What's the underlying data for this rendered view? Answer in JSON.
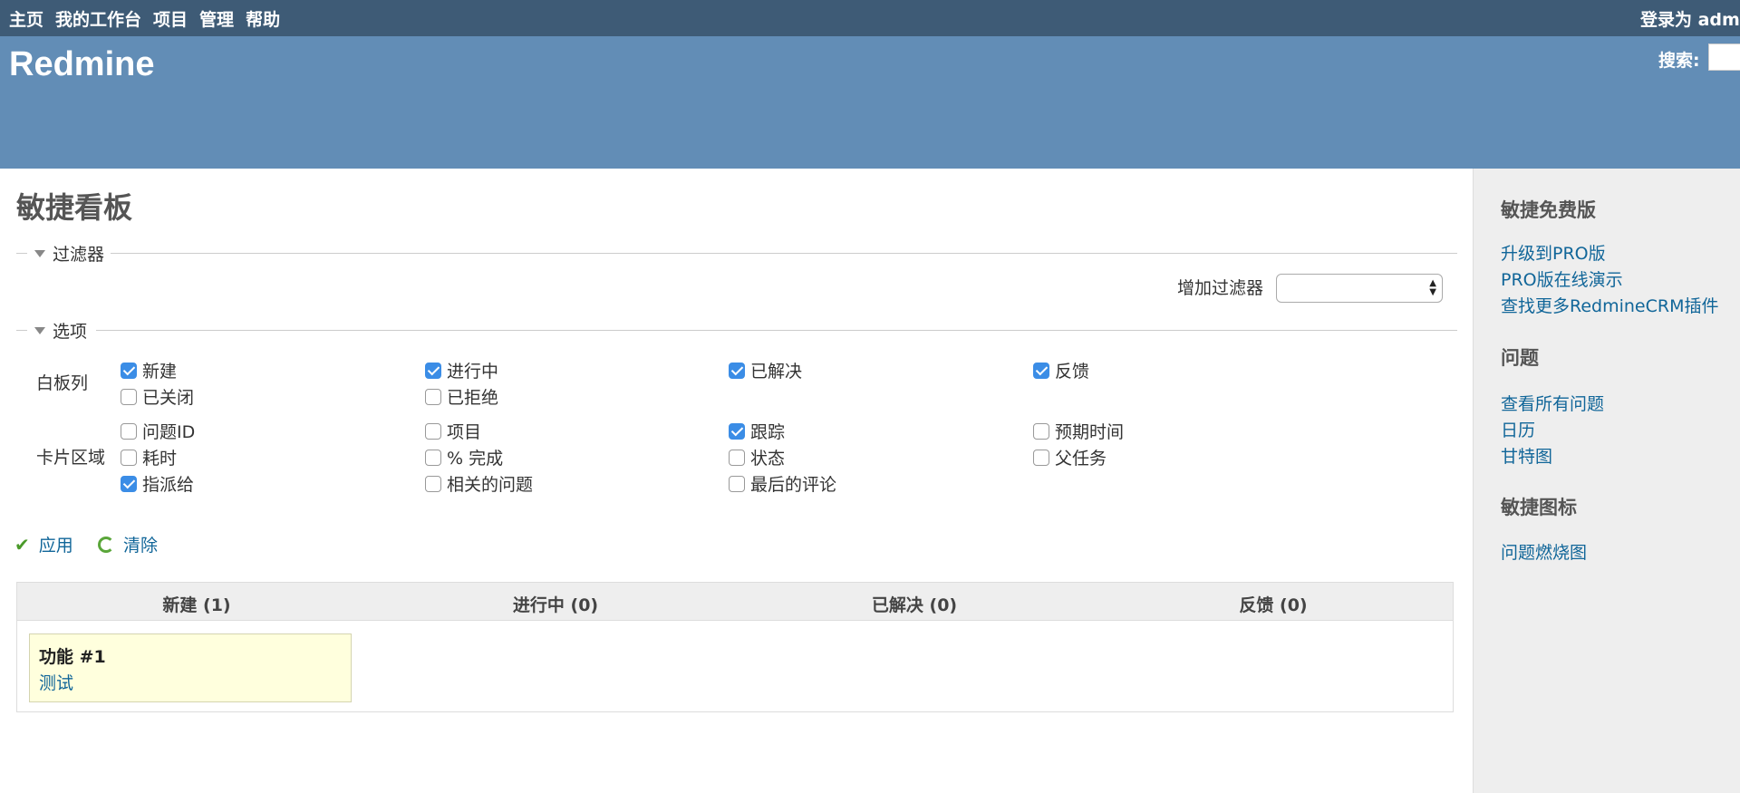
{
  "top_menu": {
    "items": [
      "主页",
      "我的工作台",
      "项目",
      "管理",
      "帮助"
    ],
    "login": "登录为 adm"
  },
  "header": {
    "title": "Redmine",
    "search_label": "搜索:",
    "search_value": ""
  },
  "page": {
    "title": "敏捷看板",
    "filters_legend": "过滤器",
    "add_filter_label": "增加过滤器",
    "add_filter_selected": "",
    "options_legend": "选项",
    "board_columns_label": "白板列",
    "card_fields_label": "卡片区域",
    "board_columns": [
      {
        "label": "新建",
        "checked": true
      },
      {
        "label": "进行中",
        "checked": true
      },
      {
        "label": "已解决",
        "checked": true
      },
      {
        "label": "反馈",
        "checked": true
      },
      {
        "label": "已关闭",
        "checked": false
      },
      {
        "label": "已拒绝",
        "checked": false
      }
    ],
    "card_fields": [
      {
        "label": "问题ID",
        "checked": false
      },
      {
        "label": "项目",
        "checked": false
      },
      {
        "label": "跟踪",
        "checked": true
      },
      {
        "label": "预期时间",
        "checked": false
      },
      {
        "label": "耗时",
        "checked": false
      },
      {
        "label": "% 完成",
        "checked": false
      },
      {
        "label": "状态",
        "checked": false
      },
      {
        "label": "父任务",
        "checked": false
      },
      {
        "label": "指派给",
        "checked": true
      },
      {
        "label": "相关的问题",
        "checked": false
      },
      {
        "label": "最后的评论",
        "checked": false
      }
    ],
    "apply_label": "应用",
    "clear_label": "清除"
  },
  "board": {
    "columns": [
      "新建 (1)",
      "进行中 (0)",
      "已解决 (0)",
      "反馈 (0)"
    ],
    "card": {
      "title": "功能 #1",
      "subject": "测试"
    }
  },
  "sidebar": {
    "section1_title": "敏捷免费版",
    "section1_links": [
      "升级到PRO版",
      "PRO版在线演示",
      "查找更多RedmineCRM插件"
    ],
    "section2_title": "问题",
    "section2_links": [
      "查看所有问题",
      "日历",
      "甘特图"
    ],
    "section3_title": "敏捷图标",
    "section3_links": [
      "问题燃烧图"
    ]
  },
  "colors": {
    "top_menu_bg": "#3e5b76",
    "header_bg": "#628db6",
    "link": "#116699",
    "checkbox_checked": "#3b8de6",
    "card_bg": "#ffffdd"
  }
}
